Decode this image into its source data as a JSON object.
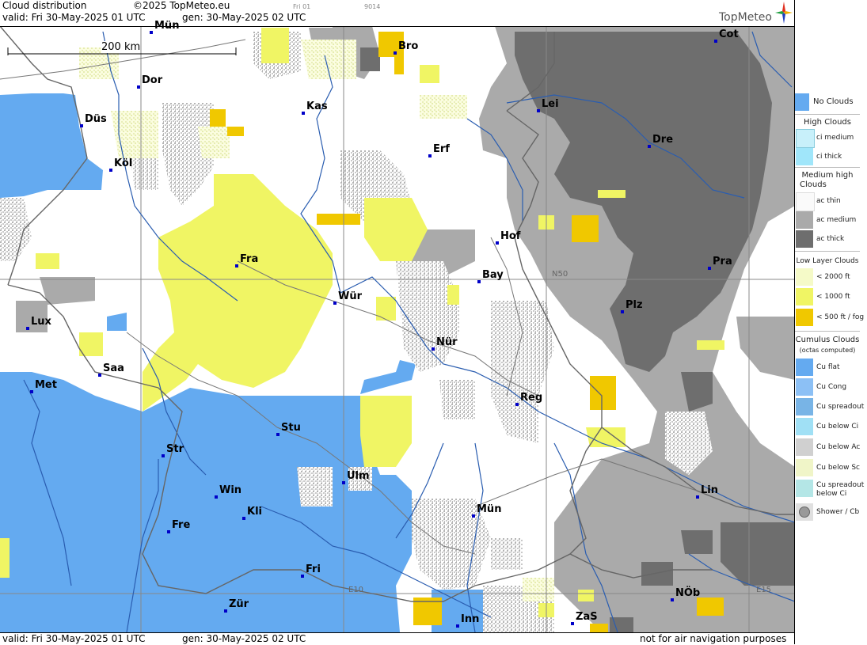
{
  "header": {
    "title": "Cloud distribution",
    "copyright": "©2025 TopMeteo.eu",
    "valid": "valid:  Fri  30-May-2025  01 UTC",
    "gen": "gen: 30-May-2025 02 UTC",
    "tag1": "Fri 01",
    "tag2": "9014",
    "brand": "TopMeteo"
  },
  "footer": {
    "valid": "valid:  Fri  30-May-2025  01 UTC",
    "gen": "gen: 30-May-2025 02 UTC",
    "disclaimer": "not for air navigation purposes"
  },
  "scale": "200 km",
  "grid_labels": {
    "n50": "N50",
    "e10": "E10",
    "e15": "E15"
  },
  "cities": [
    {
      "name": "Mün",
      "id": "muenster"
    },
    {
      "name": "Bro",
      "id": "brocken"
    },
    {
      "name": "Cot",
      "id": "cottbus"
    },
    {
      "name": "Dor",
      "id": "dortmund"
    },
    {
      "name": "Kas",
      "id": "kassel"
    },
    {
      "name": "Lei",
      "id": "leipzig"
    },
    {
      "name": "Düs",
      "id": "duesseldorf"
    },
    {
      "name": "Dre",
      "id": "dresden"
    },
    {
      "name": "Erf",
      "id": "erfurt"
    },
    {
      "name": "Köl",
      "id": "koeln"
    },
    {
      "name": "Hof",
      "id": "hof"
    },
    {
      "name": "Fra",
      "id": "frankfurt"
    },
    {
      "name": "Bay",
      "id": "bayreuth"
    },
    {
      "name": "Pra",
      "id": "praha"
    },
    {
      "name": "Wür",
      "id": "wuerzburg"
    },
    {
      "name": "Plz",
      "id": "plzen"
    },
    {
      "name": "Lux",
      "id": "luxembourg"
    },
    {
      "name": "Nür",
      "id": "nuernberg"
    },
    {
      "name": "Saa",
      "id": "saarbruecken"
    },
    {
      "name": "Met",
      "id": "metz"
    },
    {
      "name": "Reg",
      "id": "regensburg"
    },
    {
      "name": "Stu",
      "id": "stuttgart"
    },
    {
      "name": "Str",
      "id": "strasbourg"
    },
    {
      "name": "Ulm",
      "id": "ulm"
    },
    {
      "name": "Win",
      "id": "winterberg"
    },
    {
      "name": "Kli",
      "id": "klippeneck"
    },
    {
      "name": "Lin",
      "id": "linz"
    },
    {
      "name": "Mün",
      "id": "muenchen"
    },
    {
      "name": "Fre",
      "id": "freiburg"
    },
    {
      "name": "Fri",
      "id": "friedrichshafen"
    },
    {
      "name": "NÖb",
      "id": "noeb"
    },
    {
      "name": "Zür",
      "id": "zuerich"
    },
    {
      "name": "ZaS",
      "id": "zellamsee"
    },
    {
      "name": "Inn",
      "id": "innsbruck"
    }
  ],
  "legend": {
    "no_clouds": "No Clouds",
    "high_head": "High Clouds",
    "ci_medium": "ci medium",
    "ci_thick": "ci thick",
    "mid_head_1": "Medium high",
    "mid_head_2": "Clouds",
    "ac_thin": "ac thin",
    "ac_medium": "ac medium",
    "ac_thick": "ac thick",
    "low_head": "Low Layer Clouds",
    "low_2000": "< 2000 ft",
    "low_1000": "< 1000 ft",
    "low_500": "< 500 ft / fog",
    "cu_head_1": "Cumulus Clouds",
    "cu_head_2": "(octas computed)",
    "cu_flat": "Cu flat",
    "cu_cong": "Cu Cong",
    "cu_spreadout": "Cu spreadout",
    "cu_below_ci": "Cu below Ci",
    "cu_below_ac": "Cu below Ac",
    "cu_below_sc": "Cu below Sc",
    "cu_spreadout_ci_1": "Cu spreadout",
    "cu_spreadout_ci_2": "below Ci",
    "shower": "Shower / Cb"
  },
  "colors": {
    "no_clouds": "#64aaf0",
    "ac_medium": "#aaaaaa",
    "ac_thick": "#6e6e6e",
    "low_2000": "#f5fac8",
    "low_1000": "#f0f564",
    "low_500": "#f0c800",
    "cu_below_ac": "#c8c8c8"
  }
}
